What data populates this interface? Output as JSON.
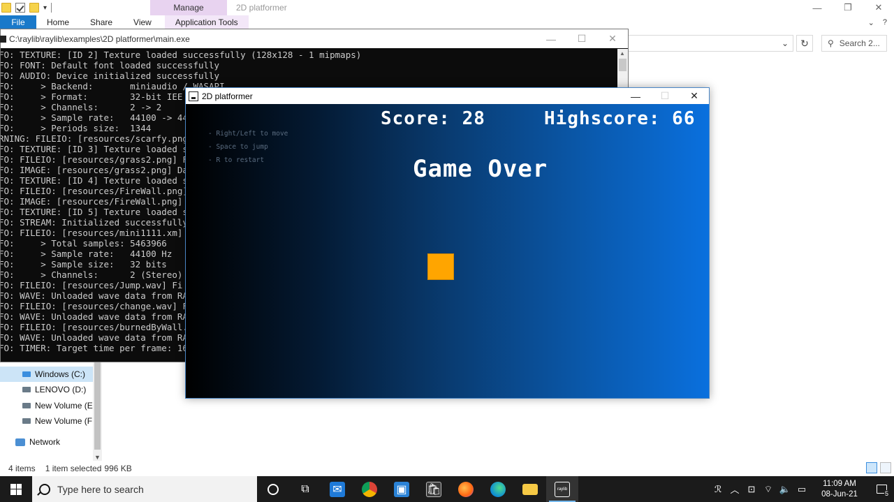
{
  "explorer": {
    "manage_tab": "Manage",
    "title": "2D platformer",
    "tabs": [
      "File",
      "Home",
      "Share",
      "View",
      "Application Tools"
    ],
    "search_placeholder": "Search 2...",
    "nav": {
      "items": [
        {
          "label": "Windows (C:)",
          "selected": true
        },
        {
          "label": "LENOVO (D:)"
        },
        {
          "label": "New Volume (E:)"
        },
        {
          "label": "New Volume (F:)"
        },
        {
          "label": "Network"
        }
      ]
    },
    "status": {
      "items_count": "4 items",
      "selection": "1 item selected",
      "size": "996 KB"
    }
  },
  "console": {
    "path": "C:\\raylib\\raylib\\examples\\2D platformer\\main.exe",
    "lines": [
      "FO: TEXTURE: [ID 2] Texture loaded successfully (128x128 - 1 mipmaps)",
      "FO: FONT: Default font loaded successfully",
      "FO: AUDIO: Device initialized successfully",
      "FO:     > Backend:       miniaudio / WASAPI",
      "FO:     > Format:        32-bit IEE",
      "FO:     > Channels:      2 -> 2",
      "FO:     > Sample rate:   44100 -> 44",
      "FO:     > Periods size:  1344",
      "RNING: FILEIO: [resources/scarfy.png",
      "FO: TEXTURE: [ID 3] Texture loaded s",
      "FO: FILEIO: [resources/grass2.png] F",
      "FO: IMAGE: [resources/grass2.png] Da",
      "FO: TEXTURE: [ID 4] Texture loaded s",
      "FO: FILEIO: [resources/FireWall.png]",
      "FO: IMAGE: [resources/FireWall.png]",
      "FO: TEXTURE: [ID 5] Texture loaded s",
      "FO: STREAM: Initialized successfully",
      "FO: FILEIO: [resources/mini1111.xm]",
      "FO:     > Total samples: 5463966",
      "FO:     > Sample rate:   44100 Hz",
      "FO:     > Sample size:   32 bits",
      "FO:     > Channels:      2 (Stereo)",
      "FO: FILEIO: [resources/Jump.wav] Fi",
      "FO: WAVE: Unloaded wave data from RA",
      "FO: FILEIO: [resources/change.wav] F",
      "FO: WAVE: Unloaded wave data from RA",
      "FO: FILEIO: [resources/burnedByWall.",
      "FO: WAVE: Unloaded wave data from RA",
      "FO: TIMER: Target time per frame: 16"
    ]
  },
  "game": {
    "title": "2D platformer",
    "score": "Score: 28",
    "highscore": "Highscore: 66",
    "game_over": "Game Over",
    "instructions": [
      "- Right/Left to move",
      "- Space to jump",
      "- R to restart"
    ],
    "player_color": "#ffa500"
  },
  "taskbar": {
    "search_placeholder": "Type here to search",
    "time": "11:09 AM",
    "date": "08-Jun-21",
    "notification_count": "5"
  }
}
